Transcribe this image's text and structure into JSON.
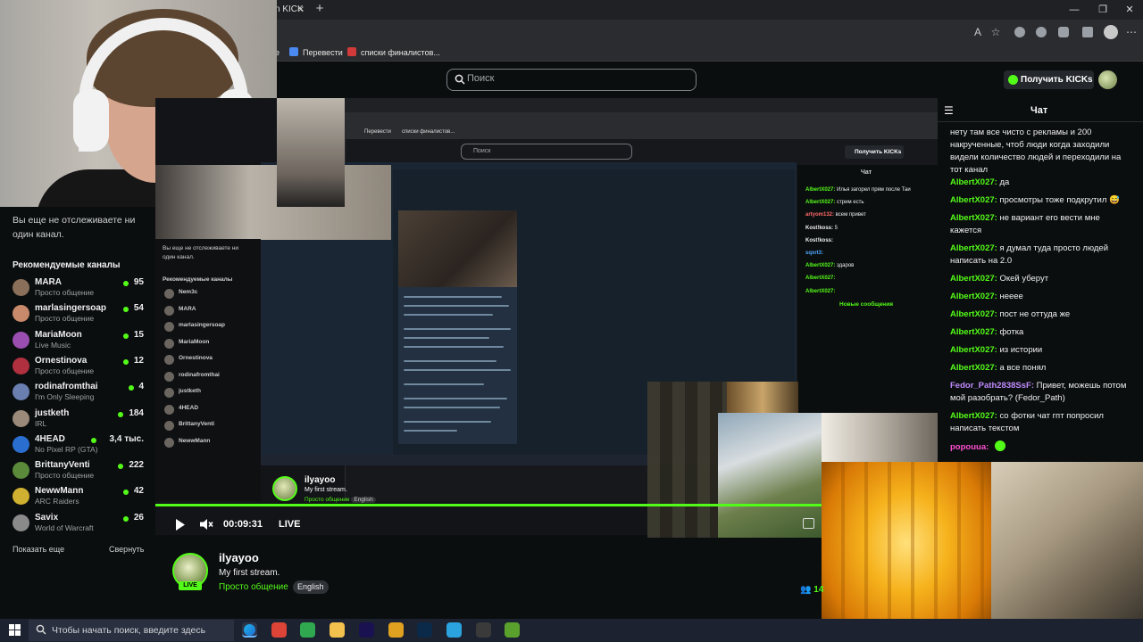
{
  "browser": {
    "tab_label": "n KICK",
    "tab_close": "×",
    "new_tab": "+",
    "win_min": "—",
    "win_max": "❐",
    "win_close": "✕",
    "toolbar_glyph_read": "A",
    "toolbar_glyph_star": "☆",
    "bookmarks": [
      {
        "label": "e"
      },
      {
        "label": "Перевести"
      },
      {
        "label": "списки финалистов..."
      }
    ]
  },
  "site": {
    "search_placeholder": "Поиск",
    "kicks_button": "Получить KICKs"
  },
  "sidebar": {
    "not_following": "Вы еще не отслеживаете ни один канал.",
    "recommended_title": "Рекомендуемые каналы",
    "channels": [
      {
        "name": "MARA",
        "category": "Просто общение",
        "viewers": "95",
        "color": "#8a6f5a"
      },
      {
        "name": "marlasingersoap",
        "category": "Просто общение",
        "viewers": "54",
        "color": "#c98a6b"
      },
      {
        "name": "MariaMoon",
        "category": "Live Music",
        "viewers": "15",
        "color": "#9a4fb0"
      },
      {
        "name": "Ornestinova",
        "category": "Просто общение",
        "viewers": "12",
        "color": "#b03040"
      },
      {
        "name": "rodinafromthai",
        "category": "I'm Only Sleeping",
        "viewers": "4",
        "color": "#6a7fb0"
      },
      {
        "name": "justketh",
        "category": "IRL",
        "viewers": "184",
        "color": "#9b8a7a"
      },
      {
        "name": "4HEAD",
        "category": "No Pixel RP (GTA)",
        "viewers": "3,4 тыс.",
        "color": "#2a6fd0"
      },
      {
        "name": "BrittanyVenti",
        "category": "Просто общение",
        "viewers": "222",
        "color": "#5a8a3a"
      },
      {
        "name": "NewwMann",
        "category": "ARC Raiders",
        "viewers": "42",
        "color": "#d0b030"
      },
      {
        "name": "Savix",
        "category": "World of Warcraft",
        "viewers": "26",
        "color": "#8a8a8a"
      }
    ],
    "show_more": "Показать еще",
    "collapse": "Свернуть"
  },
  "inner": {
    "bm1": "Перевести",
    "bm2": "списки финалистов...",
    "search": "Поиск",
    "kicks": "Получить KICKs",
    "side_msg": "Вы еще не отслеживаете ни",
    "side_msg2": "один канал.",
    "side_title": "Рекомендуемые каналы",
    "side_channels": [
      "Nem3c",
      "MARA",
      "marlasingersoap",
      "MariaMoon",
      "Ornestinova",
      "rodinafromthai",
      "justketh",
      "4HEAD",
      "BrittanyVenti",
      "NewwMann"
    ],
    "chat_title": "Чат",
    "chat_lines": [
      {
        "user": "AlbertX027:",
        "text": "Илья загорел прям после Таи",
        "cls": "g"
      },
      {
        "user": "AlbertX027:",
        "text": "стрим есть",
        "cls": "g"
      },
      {
        "user": "artyom132:",
        "text": "всем привет",
        "cls": "r"
      },
      {
        "user": "Kost!koss:",
        "text": "5",
        "cls": "w"
      },
      {
        "user": "Kost!koss:",
        "text": "",
        "cls": "w"
      },
      {
        "user": "sqxrt3:",
        "text": "",
        "cls": "b"
      },
      {
        "user": "AlbertX027:",
        "text": "здаров",
        "cls": "g"
      },
      {
        "user": "AlbertX027:",
        "text": "",
        "cls": "g"
      },
      {
        "user": "AlbertX027:",
        "text": "",
        "cls": "g"
      }
    ],
    "new_messages": "Новые сообщения",
    "streamer": "ilyayoo",
    "title": "My first stream.",
    "category": "Просто общение",
    "lang": "English"
  },
  "player": {
    "time": "00:09:31",
    "live": "LIVE",
    "progress": 1.0
  },
  "streamer": {
    "name": "ilyayoo",
    "title": "My first stream.",
    "category": "Просто общение",
    "language": "English",
    "live_badge": "LIVE",
    "viewers": "14"
  },
  "chat": {
    "title": "Чат",
    "messages": [
      {
        "user": "",
        "text": "нету там все чисто с рекламы и 200 накрученные, чтоб люди когда заходили видели количество людей и переходили на тот канал",
        "style": "u"
      },
      {
        "user": "AlbertX027:",
        "text": "да",
        "style": "u"
      },
      {
        "user": "AlbertX027:",
        "text": "просмотры тоже подкрутил 😅",
        "style": "u"
      },
      {
        "user": "AlbertX027:",
        "text": "не вариант его вести мне кажется",
        "style": "u"
      },
      {
        "user": "AlbertX027:",
        "text": "я думал туда просто людей написать на 2.0",
        "style": "u"
      },
      {
        "user": "AlbertX027:",
        "text": "Окей уберут",
        "style": "u"
      },
      {
        "user": "AlbertX027:",
        "text": "нееее",
        "style": "u"
      },
      {
        "user": "AlbertX027:",
        "text": "пост не оттуда же",
        "style": "u"
      },
      {
        "user": "AlbertX027:",
        "text": "фотка",
        "style": "u"
      },
      {
        "user": "AlbertX027:",
        "text": "из истории",
        "style": "u"
      },
      {
        "user": "AlbertX027:",
        "text": "а все понял",
        "style": "u"
      },
      {
        "user": "Fedor_Path2838SsF:",
        "text": "Привет, можешь потом мой разобрать? (Fedor_Path)",
        "style": "u2"
      },
      {
        "user": "AlbertX027:",
        "text": "со фотки чат гпт попросил написать текстом",
        "style": "u"
      },
      {
        "user": "popouua:",
        "text": "",
        "style": "u3"
      }
    ]
  },
  "taskbar": {
    "search_placeholder": "Чтобы начать поиск, введите здесь",
    "apps": [
      {
        "name": "edge",
        "color": "#1f8fe0"
      },
      {
        "name": "chrome",
        "color": "#db4437"
      },
      {
        "name": "chrome-2",
        "color": "#2fa84f"
      },
      {
        "name": "explorer",
        "color": "#f2c14e"
      },
      {
        "name": "premiere",
        "color": "#1a1150"
      },
      {
        "name": "chrome-3",
        "color": "#e0a020"
      },
      {
        "name": "photoshop",
        "color": "#0b2a4a"
      },
      {
        "name": "telegram",
        "color": "#2aa3df"
      },
      {
        "name": "obs",
        "color": "#3a3a3a"
      },
      {
        "name": "minecraft",
        "color": "#5aa02c"
      }
    ]
  }
}
